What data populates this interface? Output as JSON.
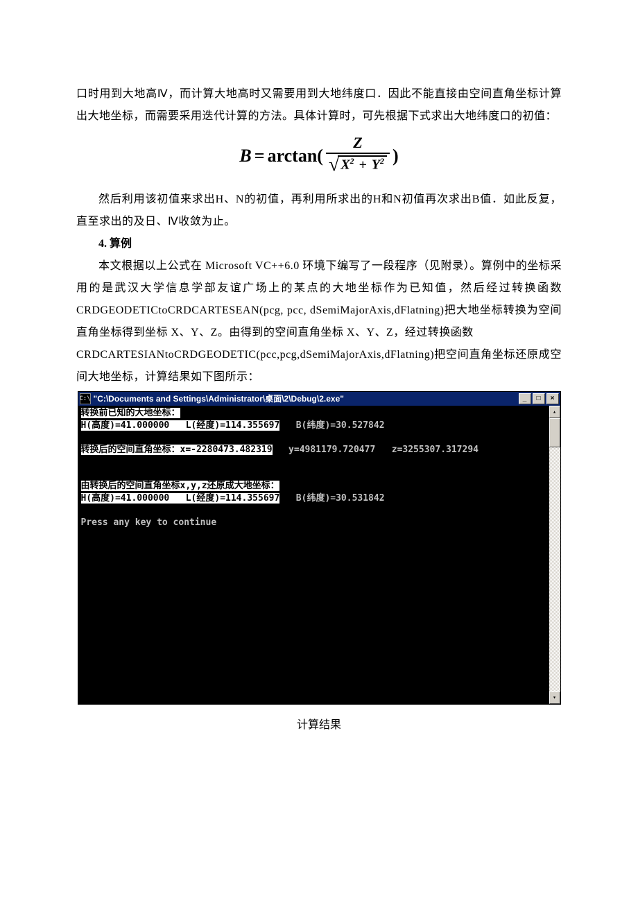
{
  "para1": "口时用到大地高Ⅳ，而计算大地高时又需要用到大地纬度口．因此不能直接由空间直角坐标计算出大地坐标，而需要采用迭代计算的方法。具体计算时，可先根据下式求出大地纬度口的初值：",
  "formula": {
    "lhs": "B",
    "eq": "=",
    "fn": "arctan(",
    "num": "Z",
    "sqrt_body_1": "X",
    "sqrt_body_plus": "+",
    "sqrt_body_2": "Y",
    "close": ")"
  },
  "para2": "然后利用该初值来求出H、N的初值，再利用所求出的H和N初值再次求出B值．如此反复，直至求出的及日、Ⅳ收敛为止。",
  "section4_head": "4. 算例",
  "para3a": "本文根据以上公式在 Microsoft VC++6.0 环境下编写了一段程序（见附录）。算例中的坐标采用的是武汉大学信息学部友谊广场上的某点的大地坐标作为已知值，然后经过转换函数 CRDGEODETICtoCRDCARTESEAN(pcg, pcc, dSemiMajorAxis,dFlatning)把大地坐标转换为空间直角坐标得到坐标 X、Y、Z。由得到的空间直角坐标 X、Y、Z，经过转换函数",
  "para3b": "CRDCARTESIANtoCRDGEODETIC(pcc,pcg,dSemiMajorAxis,dFlatning)把空间直角坐标还原成空间大地坐标，计算结果如下图所示：",
  "console": {
    "title": "\"C:\\Documents and Settings\\Administrator\\桌面\\2\\Debug\\2.exe\"",
    "icon_label": "C:\\",
    "min_glyph": "_",
    "max_glyph": "□",
    "close_glyph": "×",
    "up_glyph": "▴",
    "down_glyph": "▾",
    "line1_hi": "转换前已知的大地坐标：",
    "line2_hi_a": "H(高度)=41.000000   L(经度)=114.355697",
    "line2_rest": "   B(纬度)=30.527842",
    "blank": "",
    "line4_hi": "转换后的空间直角坐标：x=-2280473.482319",
    "line4_rest": "   y=4981179.720477   z=3255307.317294",
    "line6_hi": "由转换后的空间直角坐标x,y,z还原成大地坐标：",
    "line7_hi_a": "H(高度)=41.000000   L(经度)=114.355697",
    "line7_rest": "   B(纬度)=30.531842",
    "line9": "Press any key to continue"
  },
  "caption": "计算结果"
}
